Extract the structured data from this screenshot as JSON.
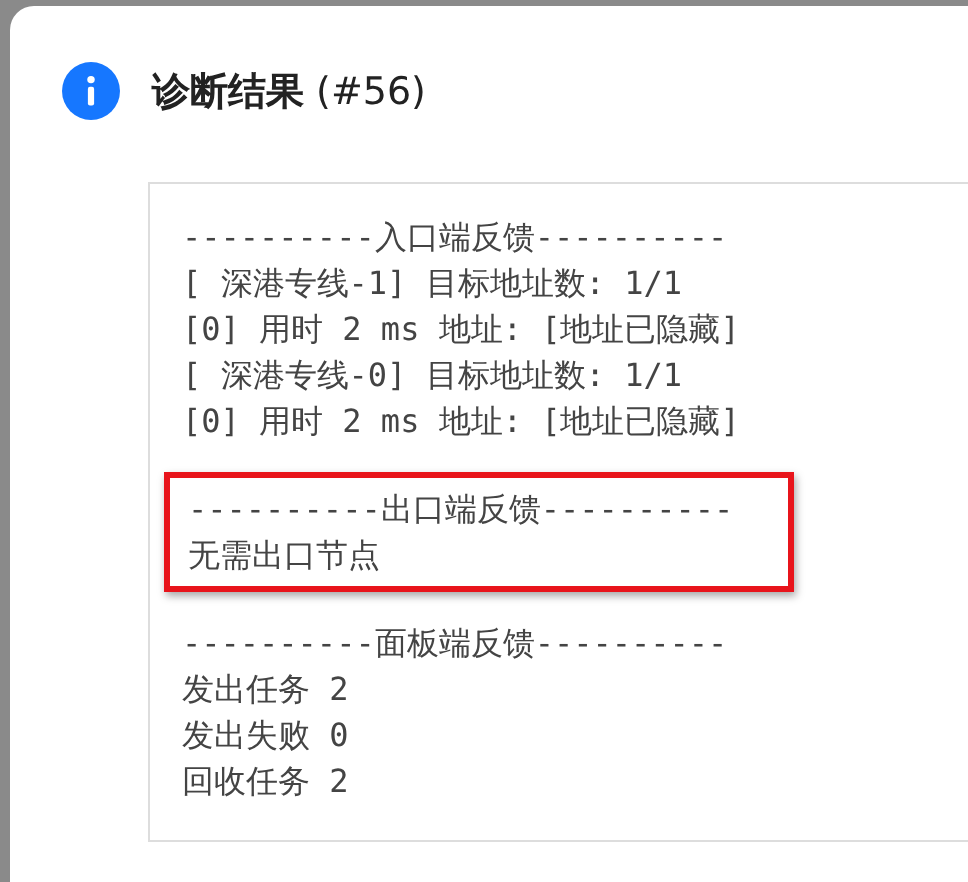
{
  "dialog": {
    "title": "诊断结果",
    "title_suffix": "(#56)"
  },
  "sections": [
    {
      "header": "----------入口端反馈----------",
      "highlighted": false,
      "lines": [
        "[ 深港专线-1] 目标地址数: 1/1",
        "[0] 用时 2 ms 地址: [地址已隐藏]",
        "[ 深港专线-0] 目标地址数: 1/1",
        "[0] 用时 2 ms 地址: [地址已隐藏]"
      ]
    },
    {
      "header": "----------出口端反馈----------",
      "highlighted": true,
      "lines": [
        "无需出口节点"
      ]
    },
    {
      "header": "----------面板端反馈----------",
      "highlighted": false,
      "lines": [
        "发出任务 2",
        "发出失败 0",
        "回收任务 2"
      ]
    }
  ]
}
